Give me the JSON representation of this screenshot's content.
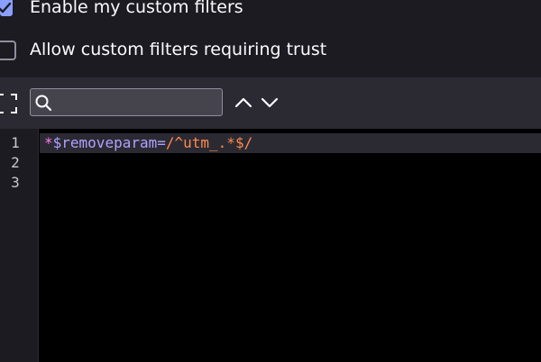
{
  "filters": {
    "enable_label": "Enable my custom filters",
    "enable_checked": true,
    "trust_label": "Allow custom filters requiring trust",
    "trust_checked": false
  },
  "toolbar": {
    "search_value": "",
    "search_placeholder": "",
    "icons": [
      "expand-icon",
      "search-icon",
      "chevron-up-icon",
      "chevron-down-icon"
    ]
  },
  "editor": {
    "line_numbers": [
      "1",
      "2",
      "3"
    ],
    "line1": {
      "star": "*",
      "option": "$removeparam",
      "equals": "=",
      "value": "/^utm_.*$/"
    }
  },
  "colors": {
    "checkbox_accent": "#8aa0ff",
    "panel_bg": "#1c1b22",
    "toolbar_bg": "#2b2a33",
    "editor_bg": "#000000",
    "token_star": "#ff7de9",
    "token_option": "#b1a2ff",
    "token_regex": "#ff8a4c"
  }
}
